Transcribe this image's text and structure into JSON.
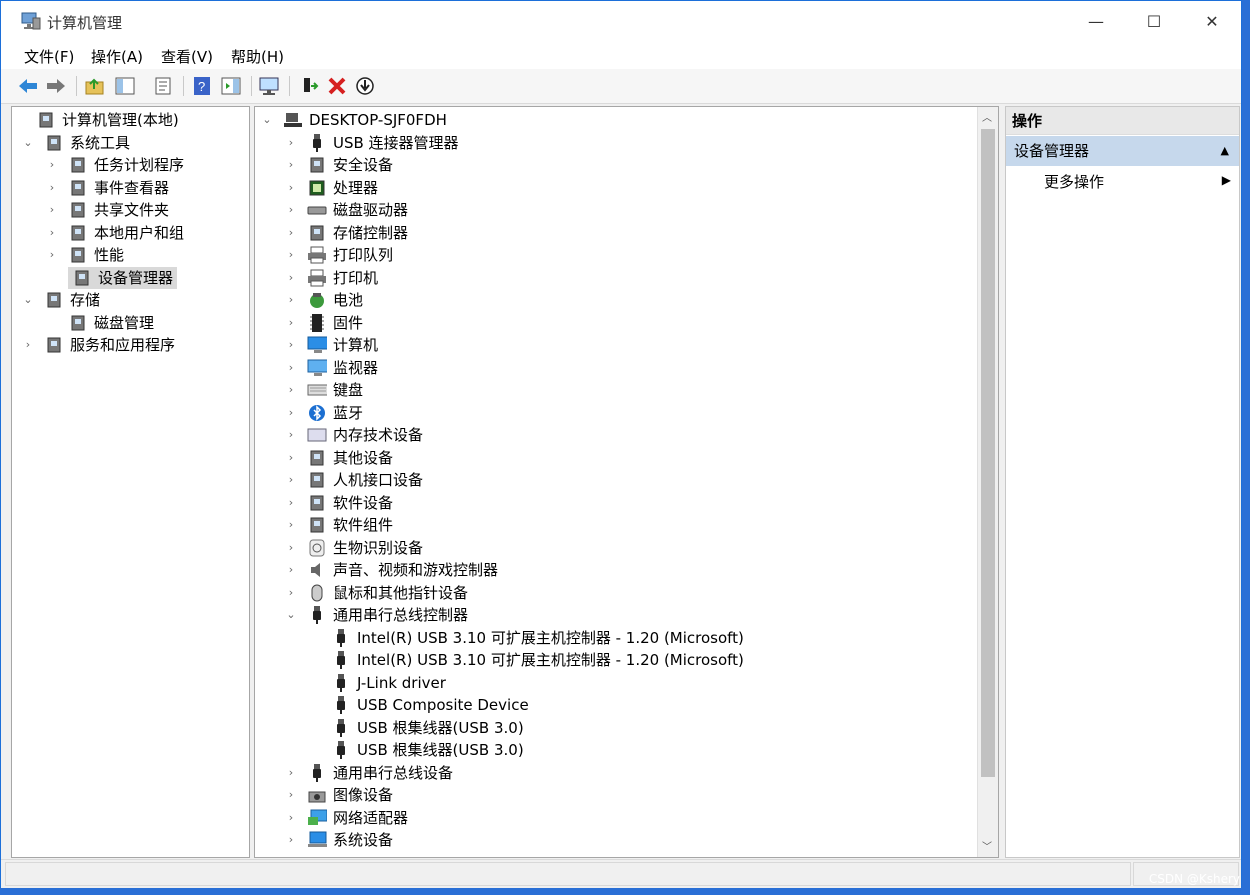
{
  "window": {
    "title": "计算机管理",
    "minimize": "—",
    "maximize": "☐",
    "close": "✕"
  },
  "menu": [
    "文件(F)",
    "操作(A)",
    "查看(V)",
    "帮助(H)"
  ],
  "toolbar": {
    "icons": [
      "back-arrow-icon",
      "forward-arrow-icon",
      "folder-up-icon",
      "show-hide-tree-icon",
      "properties-icon",
      "help-icon",
      "action-pane-icon",
      "monitor-scan-icon",
      "update-driver-icon",
      "uninstall-icon",
      "disable-device-icon"
    ]
  },
  "left_tree": [
    {
      "label": "计算机管理(本地)",
      "icon": "computer-management-icon",
      "chev": ""
    },
    {
      "label": "系统工具",
      "icon": "tools-icon",
      "chev": "⌄"
    },
    {
      "label": "任务计划程序",
      "icon": "clock-icon",
      "chev": "›"
    },
    {
      "label": "事件查看器",
      "icon": "event-viewer-icon",
      "chev": "›"
    },
    {
      "label": "共享文件夹",
      "icon": "shared-folder-icon",
      "chev": "›"
    },
    {
      "label": "本地用户和组",
      "icon": "users-icon",
      "chev": "›"
    },
    {
      "label": "性能",
      "icon": "performance-icon",
      "chev": "›"
    },
    {
      "label": "设备管理器",
      "icon": "device-manager-icon",
      "chev": ""
    },
    {
      "label": "存储",
      "icon": "storage-icon",
      "chev": "⌄"
    },
    {
      "label": "磁盘管理",
      "icon": "disk-management-icon",
      "chev": ""
    },
    {
      "label": "服务和应用程序",
      "icon": "services-icon",
      "chev": "›"
    }
  ],
  "device_root": {
    "label": "DESKTOP-SJF0FDH",
    "icon": "computer-root-icon",
    "chev": "⌄"
  },
  "devices": [
    {
      "label": "USB 连接器管理器",
      "icon": "usb-icon",
      "chev": "›"
    },
    {
      "label": "安全设备",
      "icon": "security-device-icon",
      "chev": "›"
    },
    {
      "label": "处理器",
      "icon": "processor-icon",
      "chev": "›"
    },
    {
      "label": "磁盘驱动器",
      "icon": "disk-drive-icon",
      "chev": "›"
    },
    {
      "label": "存储控制器",
      "icon": "storage-controller-icon",
      "chev": "›"
    },
    {
      "label": "打印队列",
      "icon": "print-queue-icon",
      "chev": "›"
    },
    {
      "label": "打印机",
      "icon": "printer-icon",
      "chev": "›"
    },
    {
      "label": "电池",
      "icon": "battery-icon",
      "chev": "›"
    },
    {
      "label": "固件",
      "icon": "firmware-icon",
      "chev": "›"
    },
    {
      "label": "计算机",
      "icon": "computer-icon",
      "chev": "›"
    },
    {
      "label": "监视器",
      "icon": "monitor-icon",
      "chev": "›"
    },
    {
      "label": "键盘",
      "icon": "keyboard-icon",
      "chev": "›"
    },
    {
      "label": "蓝牙",
      "icon": "bluetooth-icon",
      "chev": "›"
    },
    {
      "label": "内存技术设备",
      "icon": "memory-icon",
      "chev": "›"
    },
    {
      "label": "其他设备",
      "icon": "other-device-icon",
      "chev": "›"
    },
    {
      "label": "人机接口设备",
      "icon": "hid-icon",
      "chev": "›"
    },
    {
      "label": "软件设备",
      "icon": "software-device-icon",
      "chev": "›"
    },
    {
      "label": "软件组件",
      "icon": "software-component-icon",
      "chev": "›"
    },
    {
      "label": "生物识别设备",
      "icon": "fingerprint-icon",
      "chev": "›"
    },
    {
      "label": "声音、视频和游戏控制器",
      "icon": "speaker-icon",
      "chev": "›"
    },
    {
      "label": "鼠标和其他指针设备",
      "icon": "mouse-icon",
      "chev": "›"
    },
    {
      "label": "通用串行总线控制器",
      "icon": "usb-icon",
      "chev": "⌄"
    }
  ],
  "usb_children": [
    {
      "label": "Intel(R) USB 3.10 可扩展主机控制器 - 1.20 (Microsoft)",
      "icon": "usb-icon"
    },
    {
      "label": "Intel(R) USB 3.10 可扩展主机控制器 - 1.20 (Microsoft)",
      "icon": "usb-icon"
    },
    {
      "label": "J-Link driver",
      "icon": "usb-icon"
    },
    {
      "label": "USB Composite Device",
      "icon": "usb-icon"
    },
    {
      "label": "USB 根集线器(USB 3.0)",
      "icon": "usb-icon"
    },
    {
      "label": "USB 根集线器(USB 3.0)",
      "icon": "usb-icon"
    }
  ],
  "devices_after": [
    {
      "label": "通用串行总线设备",
      "icon": "usb-icon",
      "chev": "›"
    },
    {
      "label": "图像设备",
      "icon": "camera-icon",
      "chev": "›"
    },
    {
      "label": "网络适配器",
      "icon": "network-adapter-icon",
      "chev": "›"
    },
    {
      "label": "系统设备",
      "icon": "system-device-icon",
      "chev": "›"
    }
  ],
  "actions": {
    "header": "操作",
    "group": "设备管理器",
    "item": "更多操作",
    "collapse_glyph": "▲",
    "arrow_glyph": "▶"
  },
  "watermark": "CSDN @Kshery",
  "colors": {
    "selection": "#d9d9d9",
    "actions_group": "#c6d8ec",
    "accent": "#2a6fd6"
  }
}
